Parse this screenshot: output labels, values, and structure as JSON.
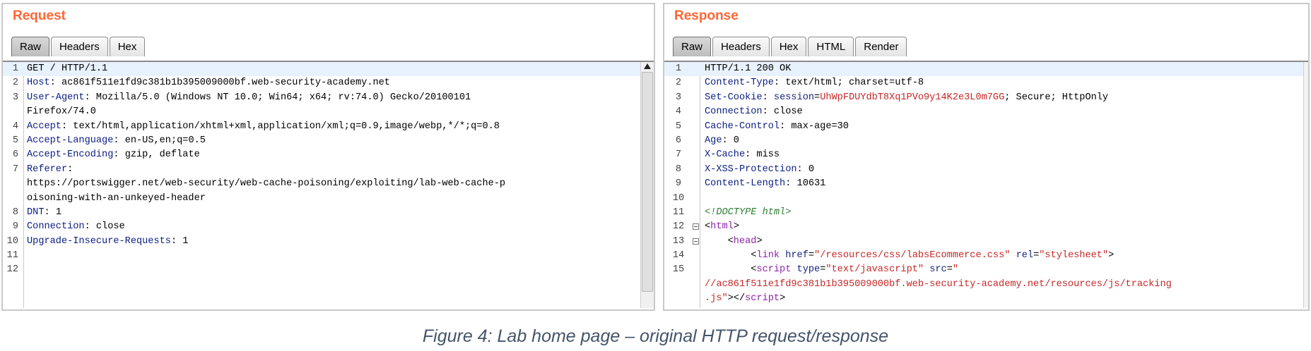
{
  "request": {
    "title": "Request",
    "tabs": [
      "Raw",
      "Headers",
      "Hex"
    ],
    "lines": [
      {
        "n": "1",
        "text": "GET / HTTP/1.1"
      },
      {
        "n": "2",
        "name": "Host",
        "value": " ac861f511e1fd9c381b1b395009000bf.web-security-academy.net"
      },
      {
        "n": "3",
        "name": "User-Agent",
        "value": " Mozilla/5.0 (Windows NT 10.0; Win64; x64; rv:74.0) Gecko/20100101"
      },
      {
        "n": "",
        "text": "Firefox/74.0"
      },
      {
        "n": "4",
        "name": "Accept",
        "value": " text/html,application/xhtml+xml,application/xml;q=0.9,image/webp,*/*;q=0.8"
      },
      {
        "n": "5",
        "name": "Accept-Language",
        "value": " en-US,en;q=0.5"
      },
      {
        "n": "6",
        "name": "Accept-Encoding",
        "value": " gzip, deflate"
      },
      {
        "n": "7",
        "name": "Referer",
        "value": ""
      },
      {
        "n": "",
        "text": "https://portswigger.net/web-security/web-cache-poisoning/exploiting/lab-web-cache-p"
      },
      {
        "n": "",
        "text": "oisoning-with-an-unkeyed-header"
      },
      {
        "n": "8",
        "name": "DNT",
        "value": " 1"
      },
      {
        "n": "9",
        "name": "Connection",
        "value": " close"
      },
      {
        "n": "10",
        "name": "Upgrade-Insecure-Requests",
        "value": " 1"
      },
      {
        "n": "11",
        "text": ""
      },
      {
        "n": "12",
        "text": ""
      }
    ]
  },
  "response": {
    "title": "Response",
    "tabs": [
      "Raw",
      "Headers",
      "Hex",
      "HTML",
      "Render"
    ],
    "lines": [
      {
        "n": "1",
        "segs": [
          {
            "t": "HTTP/1.1 200 OK"
          }
        ]
      },
      {
        "n": "2",
        "segs": [
          {
            "t": "Content-Type",
            "c": "hn"
          },
          {
            "t": ": text/html; charset=utf-8"
          }
        ]
      },
      {
        "n": "3",
        "segs": [
          {
            "t": "Set-Cookie",
            "c": "hn"
          },
          {
            "t": ": "
          },
          {
            "t": "session",
            "c": "attr"
          },
          {
            "t": "="
          },
          {
            "t": "UhWpFDUYdbT8Xq1PVo9y14K2e3L0m7GG",
            "c": "str"
          },
          {
            "t": "; Secure; HttpOnly"
          }
        ]
      },
      {
        "n": "4",
        "segs": [
          {
            "t": "Connection",
            "c": "hn"
          },
          {
            "t": ": close"
          }
        ]
      },
      {
        "n": "5",
        "segs": [
          {
            "t": "Cache-Control",
            "c": "hn"
          },
          {
            "t": ": max-age=30"
          }
        ]
      },
      {
        "n": "6",
        "segs": [
          {
            "t": "Age",
            "c": "hn"
          },
          {
            "t": ": 0"
          }
        ]
      },
      {
        "n": "7",
        "segs": [
          {
            "t": "X-Cache",
            "c": "hn"
          },
          {
            "t": ": miss"
          }
        ]
      },
      {
        "n": "8",
        "segs": [
          {
            "t": "X-XSS-Protection",
            "c": "hn"
          },
          {
            "t": ": 0"
          }
        ]
      },
      {
        "n": "9",
        "segs": [
          {
            "t": "Content-Length",
            "c": "hn"
          },
          {
            "t": ": 10631"
          }
        ]
      },
      {
        "n": "10",
        "segs": []
      },
      {
        "n": "11",
        "segs": [
          {
            "t": "<!DOCTYPE html>",
            "c": "cmt"
          }
        ]
      },
      {
        "n": "12",
        "fold": true,
        "segs": [
          {
            "t": "<"
          },
          {
            "t": "html",
            "c": "tag"
          },
          {
            "t": ">"
          }
        ]
      },
      {
        "n": "13",
        "fold": true,
        "segs": [
          {
            "t": "    <"
          },
          {
            "t": "head",
            "c": "tag"
          },
          {
            "t": ">"
          }
        ]
      },
      {
        "n": "14",
        "segs": [
          {
            "t": "        <"
          },
          {
            "t": "link",
            "c": "tag"
          },
          {
            "t": " "
          },
          {
            "t": "href",
            "c": "attr"
          },
          {
            "t": "="
          },
          {
            "t": "\"/resources/css/labsEcommerce.css\"",
            "c": "str"
          },
          {
            "t": " "
          },
          {
            "t": "rel",
            "c": "attr"
          },
          {
            "t": "="
          },
          {
            "t": "\"stylesheet\"",
            "c": "str"
          },
          {
            "t": ">"
          }
        ]
      },
      {
        "n": "15",
        "segs": [
          {
            "t": "        <"
          },
          {
            "t": "script",
            "c": "tag"
          },
          {
            "t": " "
          },
          {
            "t": "type",
            "c": "attr"
          },
          {
            "t": "="
          },
          {
            "t": "\"text/javascript\"",
            "c": "str"
          },
          {
            "t": " "
          },
          {
            "t": "src",
            "c": "attr"
          },
          {
            "t": "="
          },
          {
            "t": "\"",
            "c": "str"
          }
        ]
      },
      {
        "n": "",
        "segs": [
          {
            "t": "//ac861f511e1fd9c381b1b395009000bf.web-security-academy.net/resources/js/tracking",
            "c": "str"
          }
        ]
      },
      {
        "n": "",
        "segs": [
          {
            "t": ".js\"",
            "c": "str"
          },
          {
            "t": "></"
          },
          {
            "t": "script",
            "c": "tag"
          },
          {
            "t": ">"
          }
        ]
      }
    ]
  },
  "caption": "Figure 4: Lab home page – original HTTP request/response"
}
